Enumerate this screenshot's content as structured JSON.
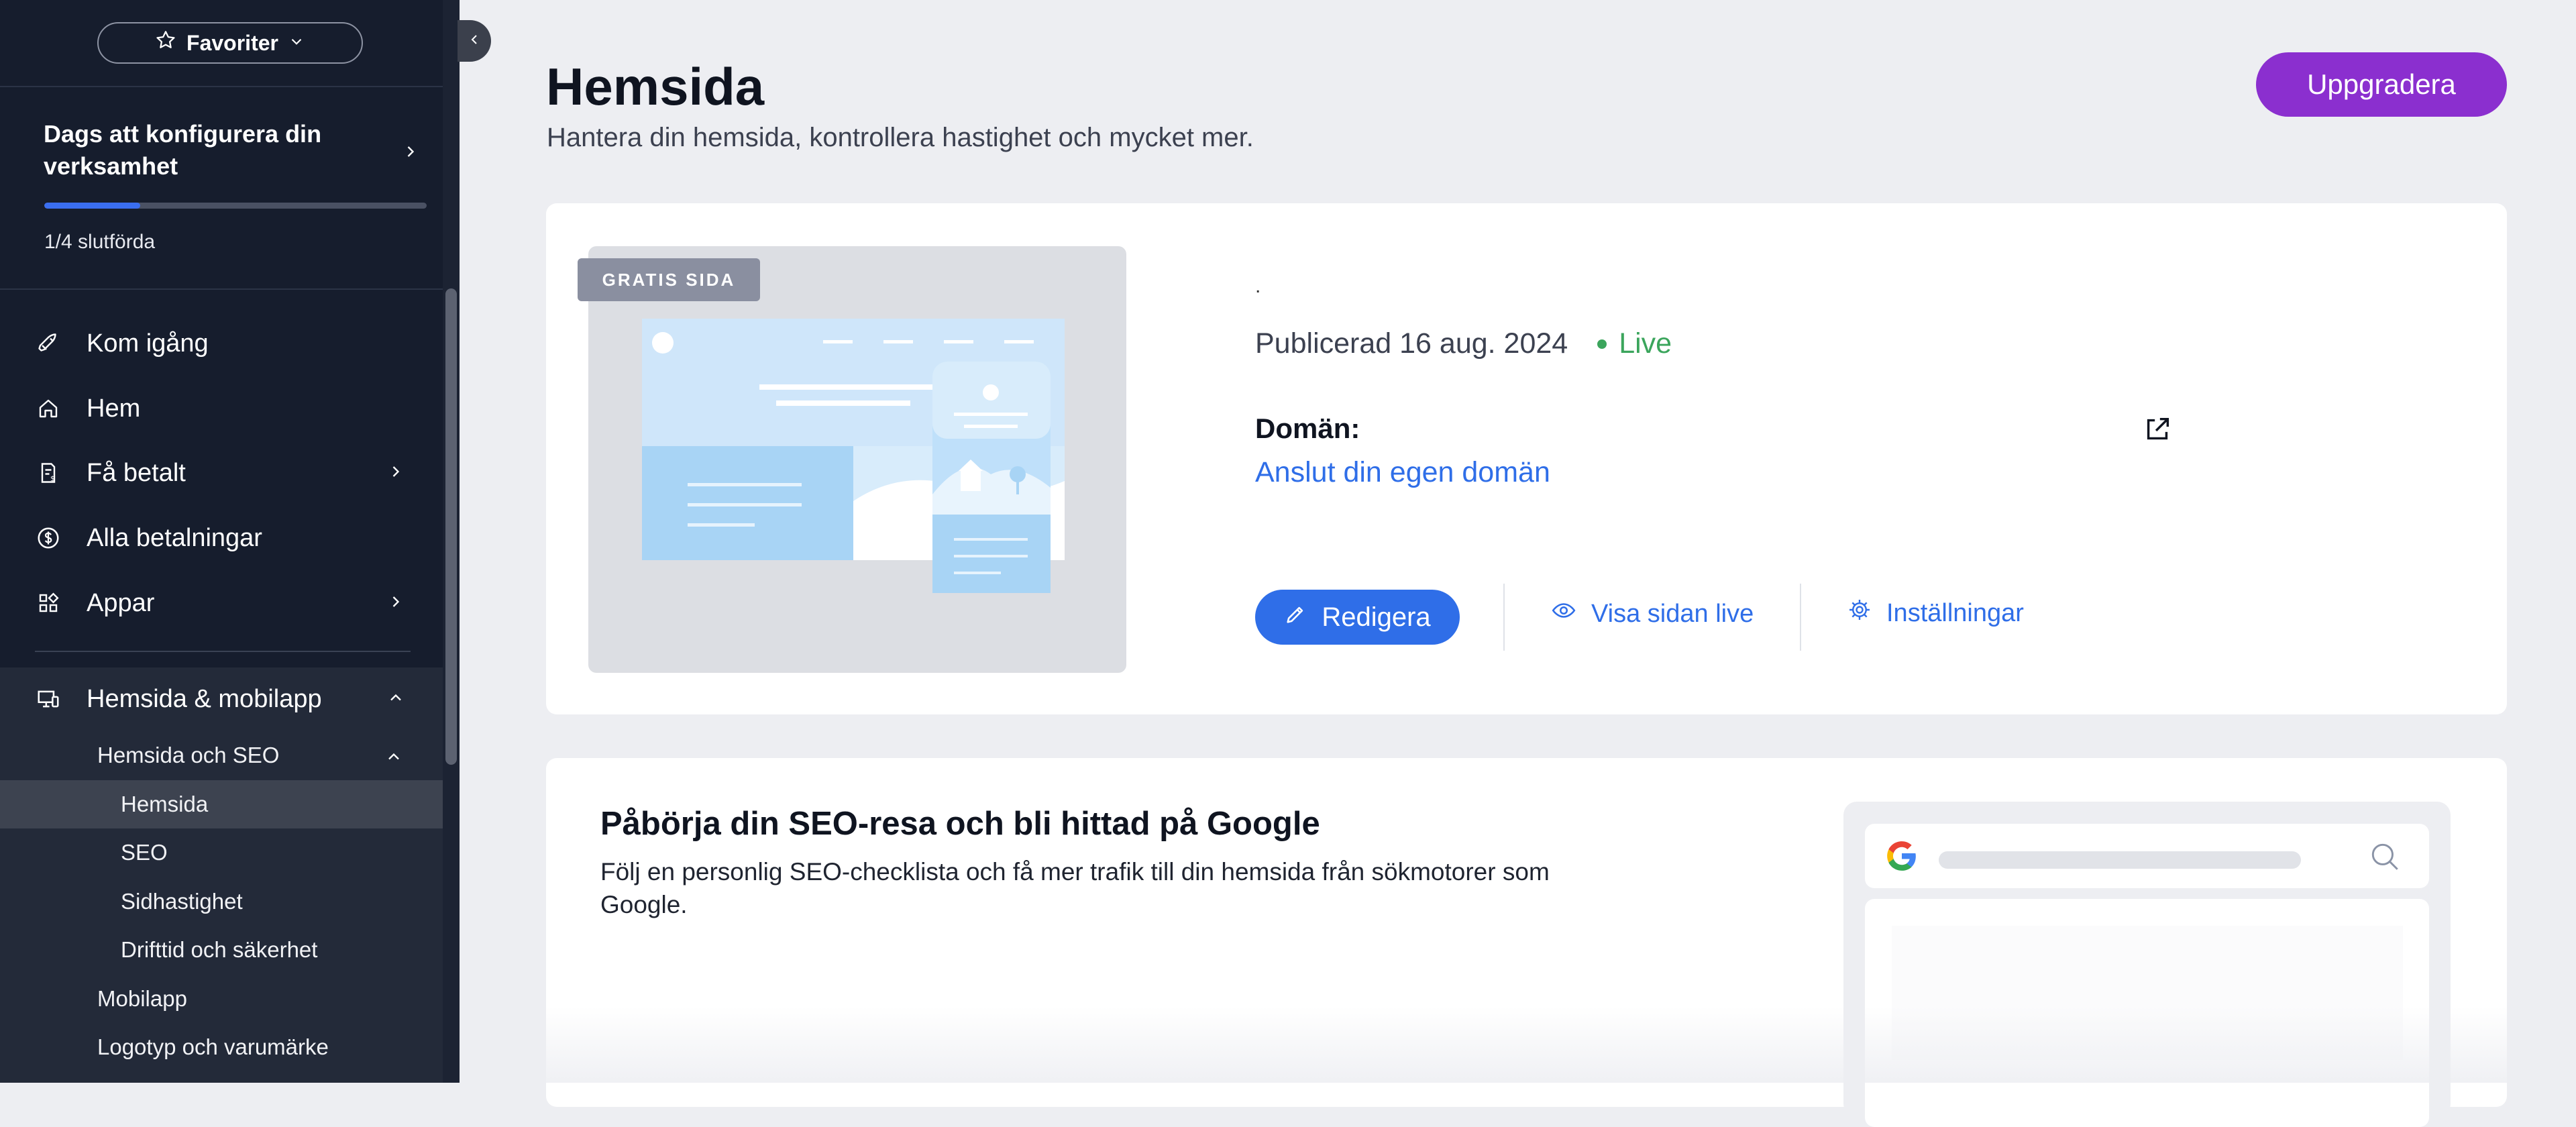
{
  "sidebar": {
    "favorites_label": "Favoriter",
    "setup": {
      "title": "Dags att konfigurera din verksamhet",
      "progress_fraction": 0.25,
      "count_label": "1/4 slutförda"
    },
    "items": [
      {
        "label": "Kom igång",
        "icon": "rocket-icon"
      },
      {
        "label": "Hem",
        "icon": "home-icon"
      },
      {
        "label": "Få betalt",
        "icon": "invoice-icon",
        "has_chevron": true
      },
      {
        "label": "Alla betalningar",
        "icon": "dollar-circle-icon"
      },
      {
        "label": "Appar",
        "icon": "apps-icon",
        "has_chevron": true
      },
      {
        "label": "Hemsida & mobilapp",
        "icon": "devices-icon",
        "expanded": true
      }
    ],
    "sub_section_label": "Hemsida och SEO",
    "sub_items": [
      "Hemsida",
      "SEO",
      "Sidhastighet",
      "Drifttid och säkerhet"
    ],
    "extra_items": [
      "Mobilapp",
      "Logotyp och varumärke"
    ],
    "active_item": "Hemsida"
  },
  "header": {
    "title": "Hemsida",
    "subtitle": "Hantera din hemsida, kontrollera hastighet och mycket mer.",
    "upgrade_label": "Uppgradera"
  },
  "site_card": {
    "badge": "GRATIS SIDA",
    "site_name": ".",
    "published": "Publicerad 16 aug. 2024",
    "status": "Live",
    "domain_label": "Domän:",
    "domain_link": "Anslut din egen domän",
    "edit_label": "Redigera",
    "view_live_label": "Visa sidan live",
    "settings_label": "Inställningar"
  },
  "seo_card": {
    "title": "Påbörja din SEO-resa och bli hittad på Google",
    "description": "Följ en personlig SEO-checklista och få mer trafik till din hemsida från sökmotorer som Google."
  },
  "colors": {
    "sidebar_bg": "#161d2d",
    "accent_blue": "#2f6ee8",
    "upgrade_purple": "#8b2fcf",
    "live_green": "#3ba55c"
  }
}
